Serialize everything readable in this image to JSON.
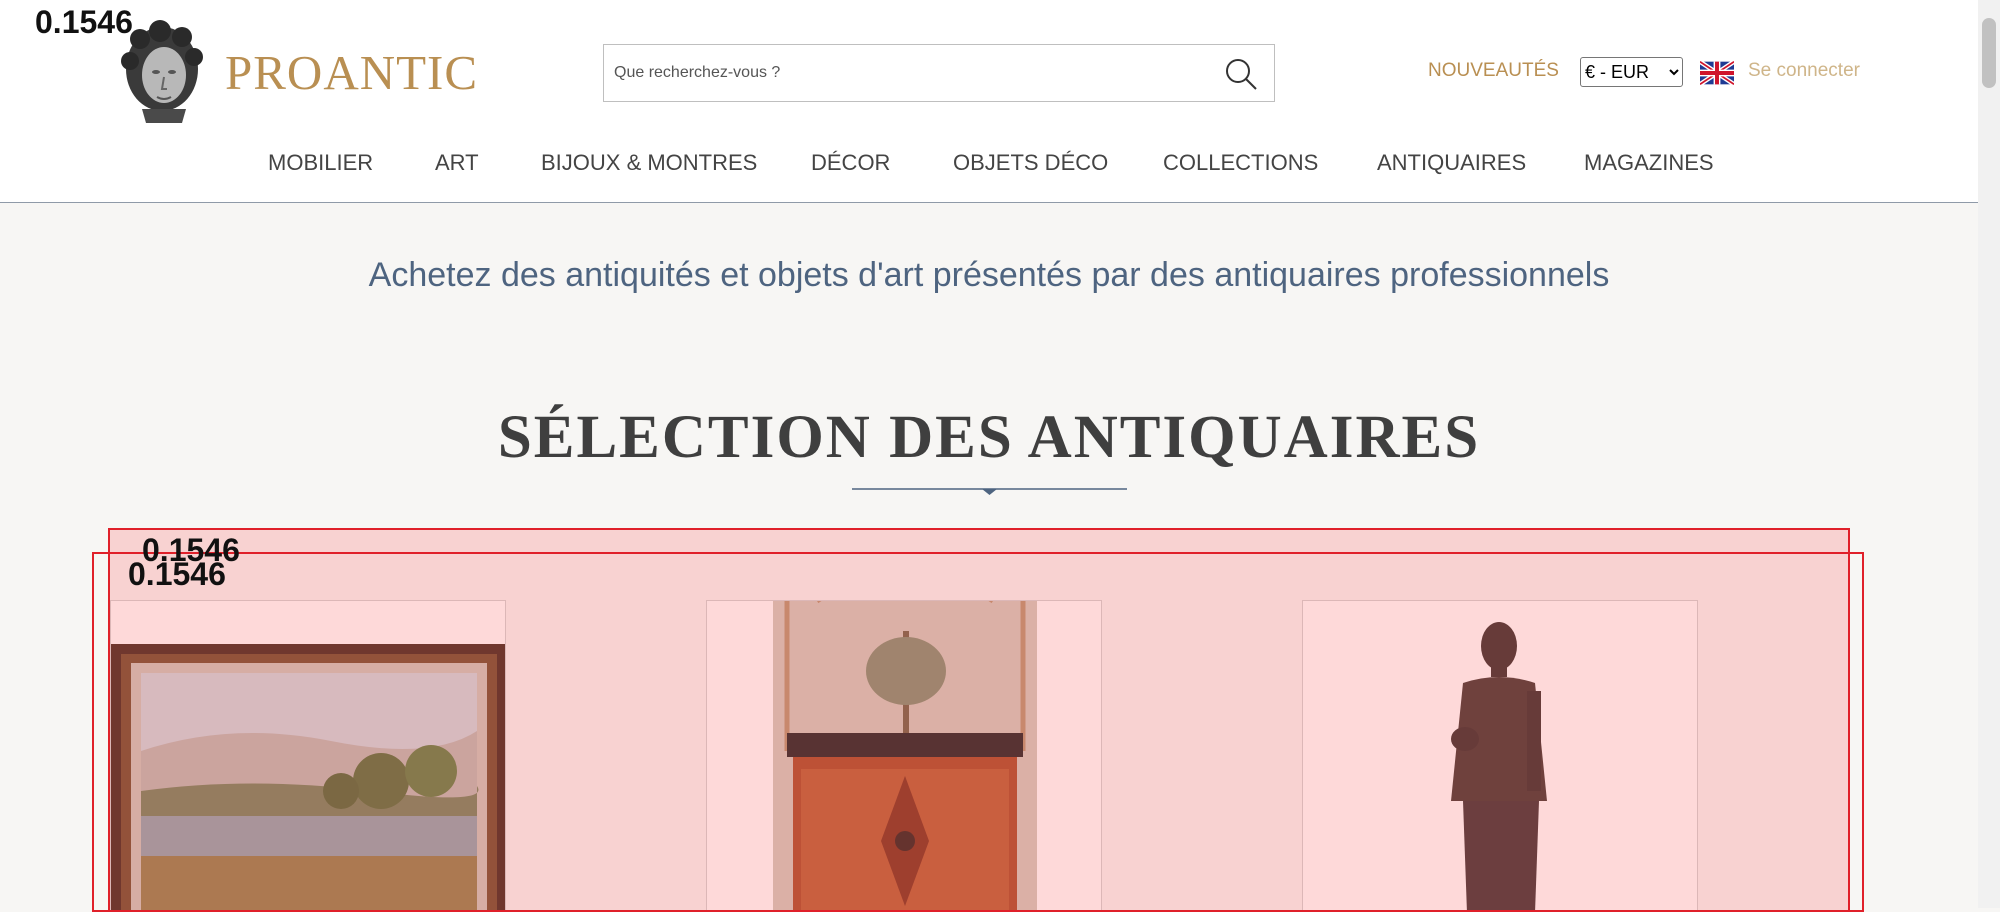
{
  "header": {
    "brand": "PROANTIC",
    "search_placeholder": "Que recherchez-vous ?",
    "nouveautes_label": "NOUVEAUTÉS",
    "currency_selected": "€ - EUR",
    "login_label": "Se connecter"
  },
  "nav": {
    "items": [
      "MOBILIER",
      "ART",
      "BIJOUX & MONTRES",
      "DÉCOR",
      "OBJETS DÉCO",
      "COLLECTIONS",
      "ANTIQUAIRES",
      "MAGAZINES"
    ]
  },
  "main": {
    "tagline": "Achetez des antiquités et objets d'art présentés par des antiquaires professionnels",
    "section_title": "SÉLECTION DES ANTIQUAIRES"
  },
  "overlay": {
    "scores": [
      "0.1546",
      "0.1546",
      "0.1546"
    ]
  },
  "colors": {
    "brand_gold": "#b98f52",
    "tagline_blue": "#4e6480",
    "highlight_red": "#e0202a"
  },
  "icons": [
    "bust-logo-icon",
    "search-icon",
    "uk-flag-icon",
    "divider-diamond-icon"
  ]
}
